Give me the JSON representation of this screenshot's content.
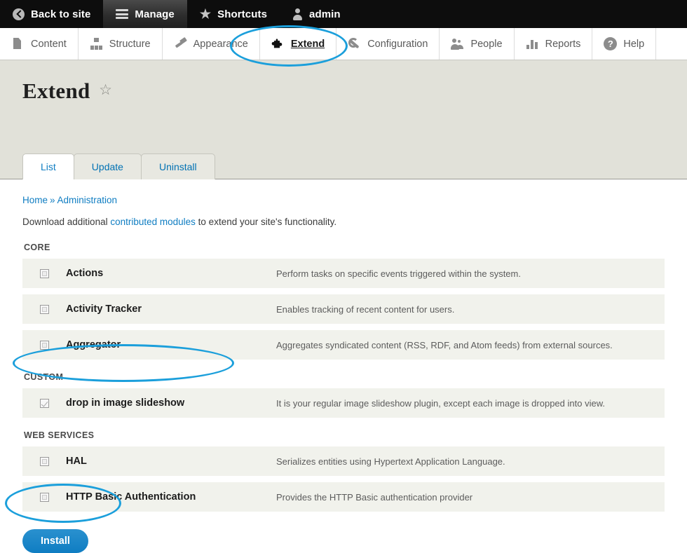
{
  "admin_bar": {
    "items": [
      {
        "label": "Back to site",
        "icon": "back-arrow-icon",
        "active": false
      },
      {
        "label": "Manage",
        "icon": "hamburger-icon",
        "active": true
      },
      {
        "label": "Shortcuts",
        "icon": "star-icon",
        "active": false
      },
      {
        "label": "admin",
        "icon": "user-icon",
        "active": false
      }
    ]
  },
  "menu_bar": {
    "items": [
      {
        "label": "Content",
        "icon": "document-icon",
        "current": false
      },
      {
        "label": "Structure",
        "icon": "structure-icon",
        "current": false
      },
      {
        "label": "Appearance",
        "icon": "paintbrush-icon",
        "current": false
      },
      {
        "label": "Extend",
        "icon": "puzzle-piece-icon",
        "current": true
      },
      {
        "label": "Configuration",
        "icon": "wrench-icon",
        "current": false
      },
      {
        "label": "People",
        "icon": "people-icon",
        "current": false
      },
      {
        "label": "Reports",
        "icon": "bar-chart-icon",
        "current": false
      },
      {
        "label": "Help",
        "icon": "question-mark-icon",
        "current": false
      }
    ]
  },
  "page": {
    "title": "Extend",
    "star_icon": "☆"
  },
  "tabs": [
    {
      "label": "List",
      "active": true
    },
    {
      "label": "Update",
      "active": false
    },
    {
      "label": "Uninstall",
      "active": false
    }
  ],
  "breadcrumb": {
    "home": "Home",
    "separator": "»",
    "current": "Administration"
  },
  "intro": {
    "before": "Download additional ",
    "link": "contributed modules",
    "after": " to extend your site's functionality."
  },
  "groups": [
    {
      "label": "CORE",
      "modules": [
        {
          "name": "Actions",
          "checked": false,
          "description": "Perform tasks on specific events triggered within the system."
        },
        {
          "name": "Activity Tracker",
          "checked": false,
          "description": "Enables tracking of recent content for users."
        },
        {
          "name": "Aggregator",
          "checked": false,
          "description": "Aggregates syndicated content (RSS, RDF, and Atom feeds) from external sources."
        }
      ]
    },
    {
      "label": "CUSTOM",
      "modules": [
        {
          "name": "drop in image slideshow",
          "checked": true,
          "description": "It is your regular image slideshow plugin, except each image is dropped into view."
        }
      ]
    },
    {
      "label": "WEB SERVICES",
      "modules": [
        {
          "name": "HAL",
          "checked": false,
          "description": "Serializes entities using Hypertext Application Language."
        },
        {
          "name": "HTTP Basic Authentication",
          "checked": false,
          "description": "Provides the HTTP Basic authentication provider"
        }
      ]
    }
  ],
  "actions": {
    "install_label": "Install"
  },
  "annotations": {
    "color": "#1b9fdb",
    "targets": [
      "extend-menu-item",
      "drop-in-image-slideshow-row",
      "install-button"
    ]
  },
  "colors": {
    "admin_bar_bg": "#0d0d0d",
    "header_band_bg": "#e1e1d9",
    "row_bg": "#f1f2ec",
    "link": "#0f7dc2",
    "install_button": "#1180c4",
    "annotation": "#1b9fdb"
  }
}
